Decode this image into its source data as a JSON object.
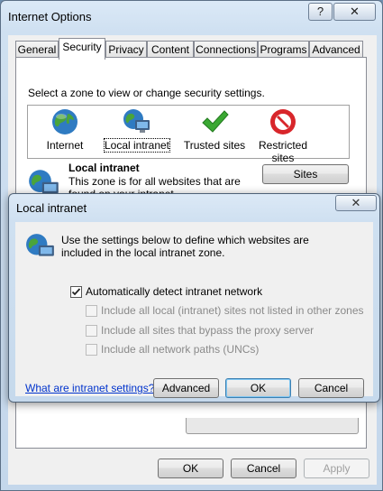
{
  "window": {
    "title": "Internet Options",
    "help_glyph": "?",
    "close_glyph": "✕"
  },
  "tabs": [
    {
      "label": "General"
    },
    {
      "label": "Security"
    },
    {
      "label": "Privacy"
    },
    {
      "label": "Content"
    },
    {
      "label": "Connections"
    },
    {
      "label": "Programs"
    },
    {
      "label": "Advanced"
    }
  ],
  "security": {
    "prompt": "Select a zone to view or change security settings.",
    "zones": [
      {
        "label": "Internet",
        "icon": "globe-icon"
      },
      {
        "label": "Local intranet",
        "icon": "intranet-icon"
      },
      {
        "label": "Trusted sites",
        "icon": "checkmark-icon"
      },
      {
        "label": "Restricted sites",
        "icon": "restricted-icon"
      }
    ],
    "selected_zone_heading": "Local intranet",
    "selected_zone_desc": "This zone is for all websites that are found on your intranet.",
    "sites_button": "Sites"
  },
  "footer": {
    "ok": "OK",
    "cancel": "Cancel",
    "apply": "Apply"
  },
  "dialog": {
    "title": "Local intranet",
    "close_glyph": "✕",
    "message": "Use the settings below to define which websites are included in the local intranet zone.",
    "options": [
      {
        "label": "Automatically detect intranet network",
        "checked": true,
        "enabled": true
      },
      {
        "label": "Include all local (intranet) sites not listed in other zones",
        "checked": false,
        "enabled": false
      },
      {
        "label": "Include all sites that bypass the proxy server",
        "checked": false,
        "enabled": false
      },
      {
        "label": "Include all network paths (UNCs)",
        "checked": false,
        "enabled": false
      }
    ],
    "help_link": "What are intranet settings?",
    "advanced": "Advanced",
    "ok": "OK",
    "cancel": "Cancel"
  }
}
